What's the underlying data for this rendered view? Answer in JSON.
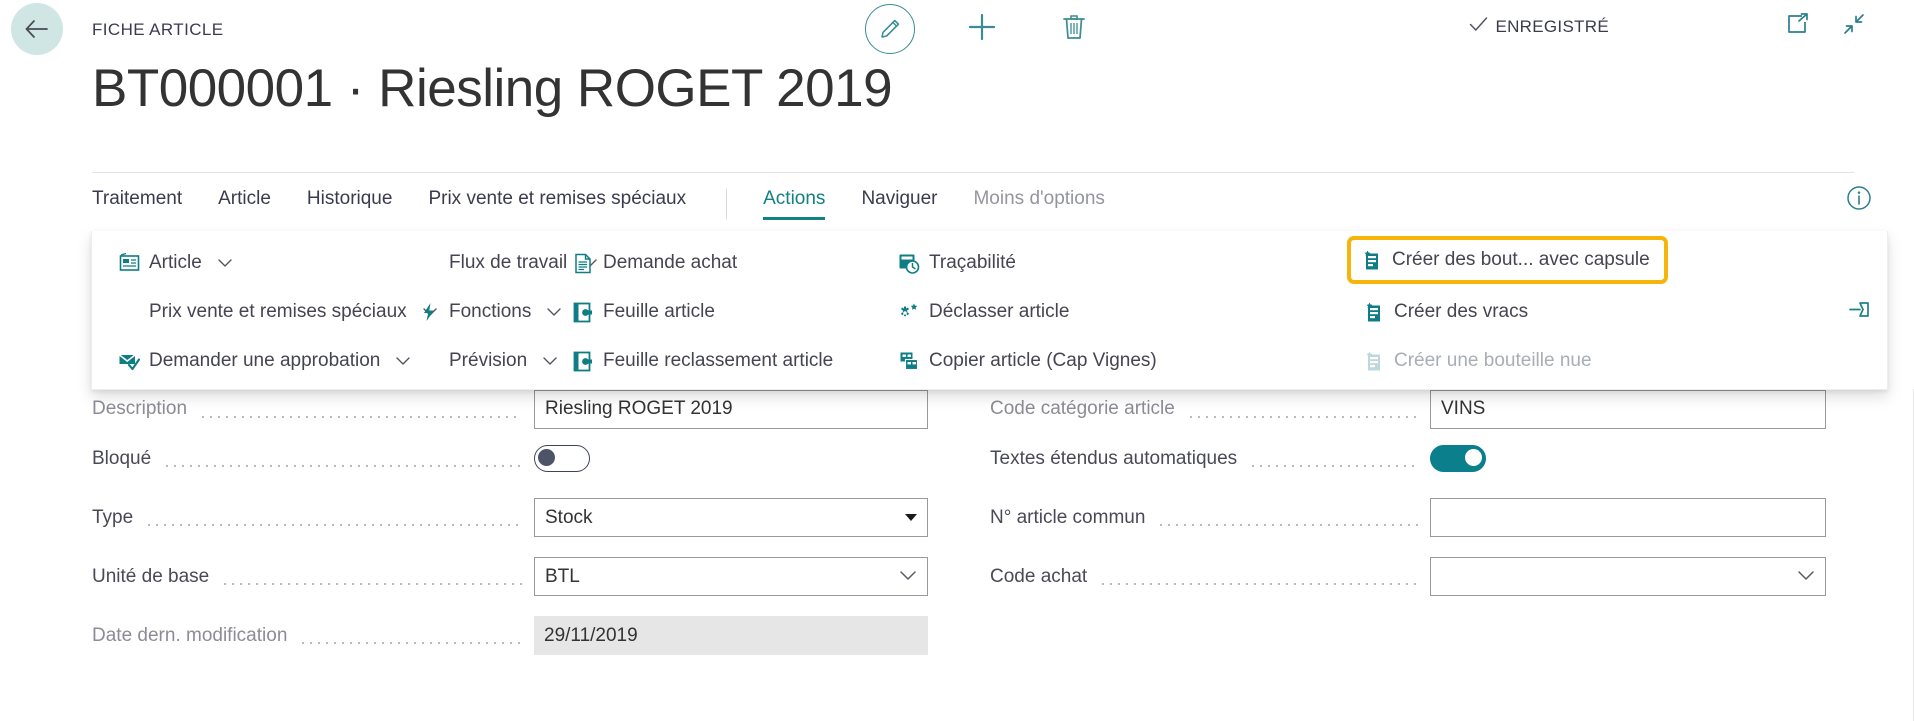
{
  "header": {
    "back_label": "back-arrow",
    "breadcrumb": "FICHE ARTICLE",
    "title": "BT000001 · Riesling ROGET 2019",
    "saved_status": "ENREGISTRÉ",
    "commands": [
      {
        "name": "edit-button",
        "icon": "pencil-icon",
        "label": "Modifier"
      },
      {
        "name": "new-button",
        "icon": "plus-icon",
        "label": "Nouveau"
      },
      {
        "name": "delete-button",
        "icon": "trash-icon",
        "label": "Supprimer"
      }
    ],
    "window_controls": [
      {
        "name": "open-in-new-window-button",
        "icon": "open-external-icon"
      },
      {
        "name": "collapse-button",
        "icon": "collapse-arrows-icon"
      }
    ]
  },
  "tabs": [
    {
      "label": "Traitement",
      "active": false,
      "muted": false
    },
    {
      "label": "Article",
      "active": false,
      "muted": false
    },
    {
      "label": "Historique",
      "active": false,
      "muted": false
    },
    {
      "label": "Prix vente et remises spéciaux",
      "active": false,
      "muted": false
    },
    {
      "label": "Actions",
      "active": true,
      "muted": false
    },
    {
      "label": "Naviguer",
      "active": false,
      "muted": false
    },
    {
      "label": "Moins d'options",
      "active": false,
      "muted": true
    }
  ],
  "ribbon": {
    "columns": [
      {
        "items": [
          {
            "label": "Article",
            "icon": "article-card-icon",
            "has_caret": true,
            "disabled": false,
            "highlighted": false
          },
          {
            "label": "Prix vente et remises spéciaux",
            "icon": "none",
            "has_caret": true,
            "disabled": false,
            "highlighted": false
          },
          {
            "label": "Demander une approbation",
            "icon": "approval-mail-icon",
            "has_caret": true,
            "disabled": false,
            "highlighted": false
          }
        ]
      },
      {
        "items": [
          {
            "label": "Flux de travail",
            "icon": "none",
            "has_caret": true,
            "disabled": false,
            "highlighted": false
          },
          {
            "label": "Fonctions",
            "icon": "lightning-icon",
            "has_caret": true,
            "disabled": false,
            "highlighted": false
          },
          {
            "label": "Prévision",
            "icon": "none",
            "has_caret": true,
            "disabled": false,
            "highlighted": false
          }
        ]
      },
      {
        "items": [
          {
            "label": "Demande achat",
            "icon": "document-lines-icon",
            "has_caret": false,
            "disabled": false,
            "highlighted": false
          },
          {
            "label": "Feuille article",
            "icon": "journal-icon",
            "has_caret": false,
            "disabled": false,
            "highlighted": false
          },
          {
            "label": "Feuille reclassement article",
            "icon": "journal-icon",
            "has_caret": false,
            "disabled": false,
            "highlighted": false
          }
        ]
      },
      {
        "items": [
          {
            "label": "Traçabilité",
            "icon": "tracking-clock-icon",
            "has_caret": false,
            "disabled": false,
            "highlighted": false
          },
          {
            "label": "Déclasser article",
            "icon": "gears-icon",
            "has_caret": false,
            "disabled": false,
            "highlighted": false
          },
          {
            "label": "Copier article (Cap Vignes)",
            "icon": "copy-icon",
            "has_caret": false,
            "disabled": false,
            "highlighted": false
          }
        ]
      },
      {
        "items": [
          {
            "label": "Créer des bout... avec capsule",
            "icon": "create-bottle-icon",
            "has_caret": false,
            "disabled": false,
            "highlighted": true
          },
          {
            "label": "Créer des vracs",
            "icon": "create-bottle-icon",
            "has_caret": false,
            "disabled": false,
            "highlighted": false
          },
          {
            "label": "Créer une bouteille nue",
            "icon": "create-bottle-icon",
            "has_caret": false,
            "disabled": true,
            "highlighted": false
          }
        ]
      }
    ],
    "pin_icon": "pin-icon",
    "highlight_color": "#f5b50a"
  },
  "form": {
    "left": [
      {
        "label": "Description",
        "value": "Riesling ROGET 2019",
        "control": "textbox",
        "occluded": true
      },
      {
        "label": "Bloqué",
        "value": "",
        "control": "toggle",
        "toggle_on": false
      },
      {
        "label": "Type",
        "value": "Stock",
        "control": "select"
      },
      {
        "label": "Unité de base",
        "value": "BTL",
        "control": "lookup"
      },
      {
        "label": "Date dern. modification",
        "value": "29/11/2019",
        "control": "readonly"
      }
    ],
    "right": [
      {
        "label": "Code catégorie article",
        "value": "VINS",
        "control": "textbox",
        "occluded": true
      },
      {
        "label": "Textes étendus automatiques",
        "value": "",
        "control": "toggle",
        "toggle_on": true
      },
      {
        "label": "N° article commun",
        "value": "",
        "control": "textbox"
      },
      {
        "label": "Code achat",
        "value": "",
        "control": "lookup"
      }
    ]
  },
  "theme": {
    "accent": "#128186",
    "teal": "#0b7f8c",
    "highlight": "#f5b50a",
    "text": "#333333",
    "muted": "#8c8c96"
  }
}
